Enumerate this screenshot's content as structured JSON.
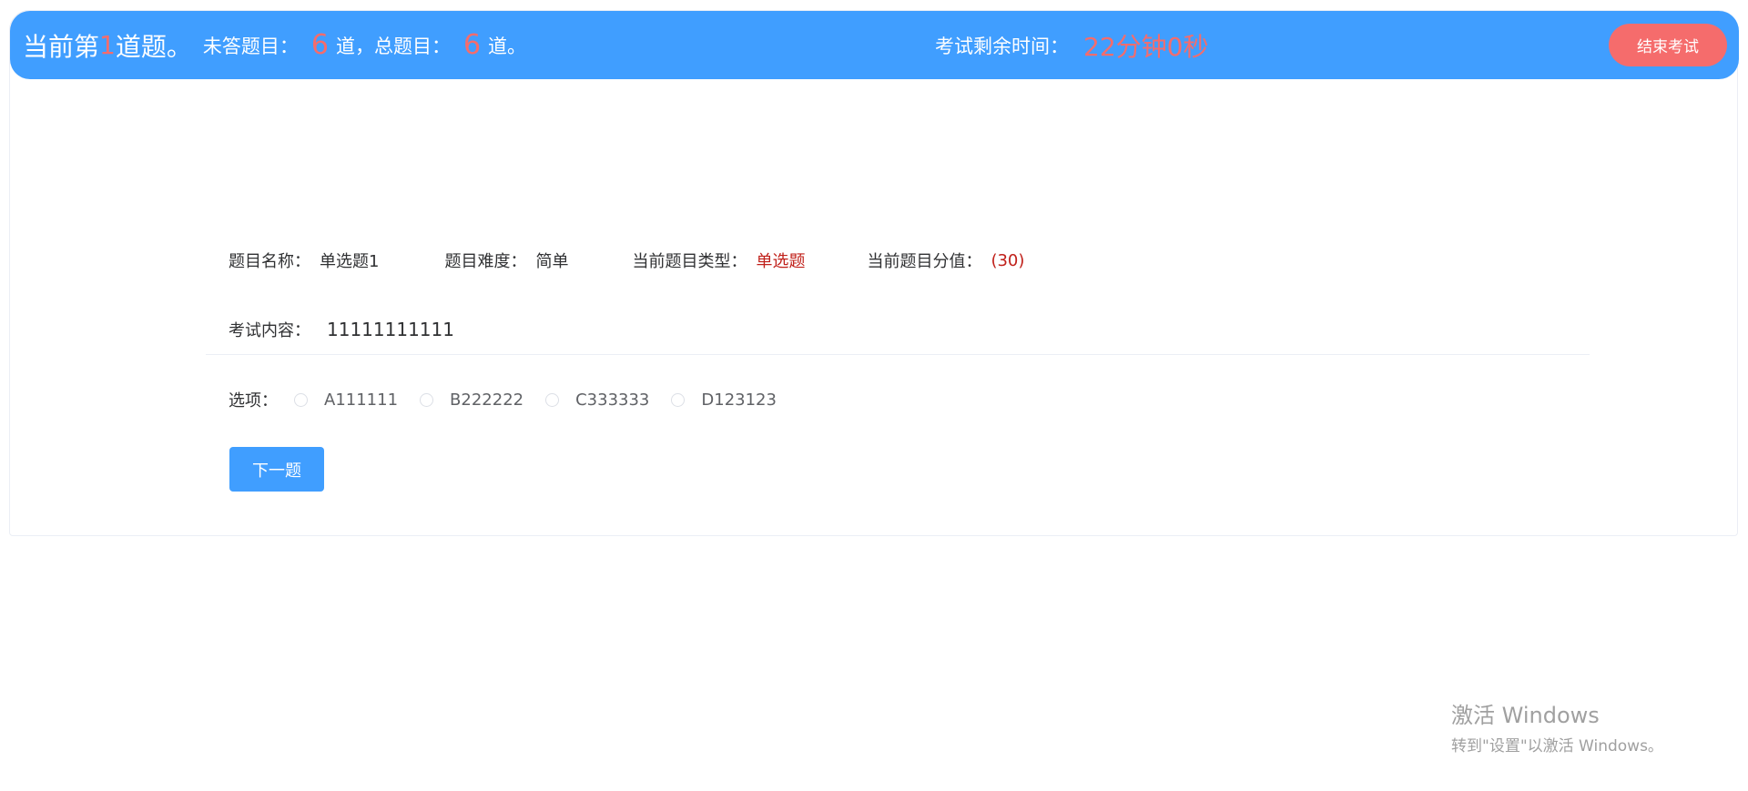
{
  "header": {
    "current_prefix": "当前第",
    "current_number": "1",
    "current_suffix": " 道题。",
    "unanswered_label": "未答题目：",
    "unanswered_count": "6",
    "unanswered_suffix": "道，",
    "total_label": "总题目：",
    "total_count": "6",
    "total_suffix": "道。",
    "timer_label": "考试剩余时间：",
    "timer_value": "22分钟0秒",
    "end_button_label": "结束考试"
  },
  "question": {
    "name_label": "题目名称：",
    "name_value": "单选题1",
    "difficulty_label": "题目难度：",
    "difficulty_value": "简单",
    "type_label": "当前题目类型：",
    "type_value": "单选题",
    "score_label": "当前题目分值：",
    "score_value": "(30)",
    "content_label": "考试内容：",
    "content_value": "11111111111",
    "options_label": "选项：",
    "options": [
      {
        "label": "A111111",
        "selected": false
      },
      {
        "label": "B222222",
        "selected": false
      },
      {
        "label": "C333333",
        "selected": false
      },
      {
        "label": "D123123",
        "selected": false
      }
    ],
    "next_button_label": "下一题"
  },
  "watermark": {
    "title": "激活 Windows",
    "subtitle": "转到\"设置\"以激活 Windows。"
  },
  "colors": {
    "primary": "#409eff",
    "danger": "#f56c6c",
    "value_red": "#c0201a"
  }
}
